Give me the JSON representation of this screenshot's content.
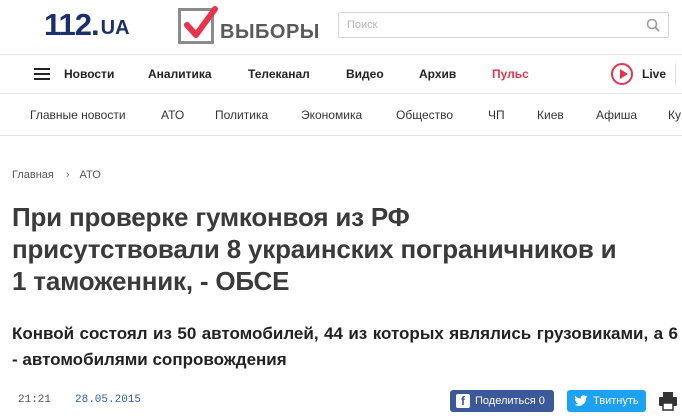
{
  "header": {
    "logo_num": "112",
    "logo_dot": ".",
    "logo_ua": "UA",
    "vybory": "ВЫБОРЫ",
    "search_placeholder": "Поиск"
  },
  "mainnav": {
    "items": [
      "Новости",
      "Аналитика",
      "Телеканал",
      "Видео",
      "Архив",
      "Пульс"
    ],
    "live": "Live"
  },
  "subnav": {
    "items": [
      "Главные новости",
      "АТО",
      "Политика",
      "Экономика",
      "Общество",
      "ЧП",
      "Киев",
      "Афиша",
      "Ку"
    ]
  },
  "breadcrumb": {
    "home": "Главная",
    "section": "АТО"
  },
  "article": {
    "title": "При проверке гумконвоя из РФ присутствовали 8 украинских пограничников и 1 таможенник, - ОБСЕ",
    "subtitle": "Конвой состоял из 50 автомобилей, 44 из которых являлись грузовиками, а 6 - автомобилями сопровождения",
    "time": "21:21",
    "date": "28.05.2015"
  },
  "share": {
    "facebook": "Поделиться 0",
    "twitter": "Твитнуть"
  },
  "colors": {
    "brand": "#1b2f6e",
    "pulse": "#e8334a",
    "facebook": "#3b5998",
    "twitter": "#1da1f2"
  }
}
